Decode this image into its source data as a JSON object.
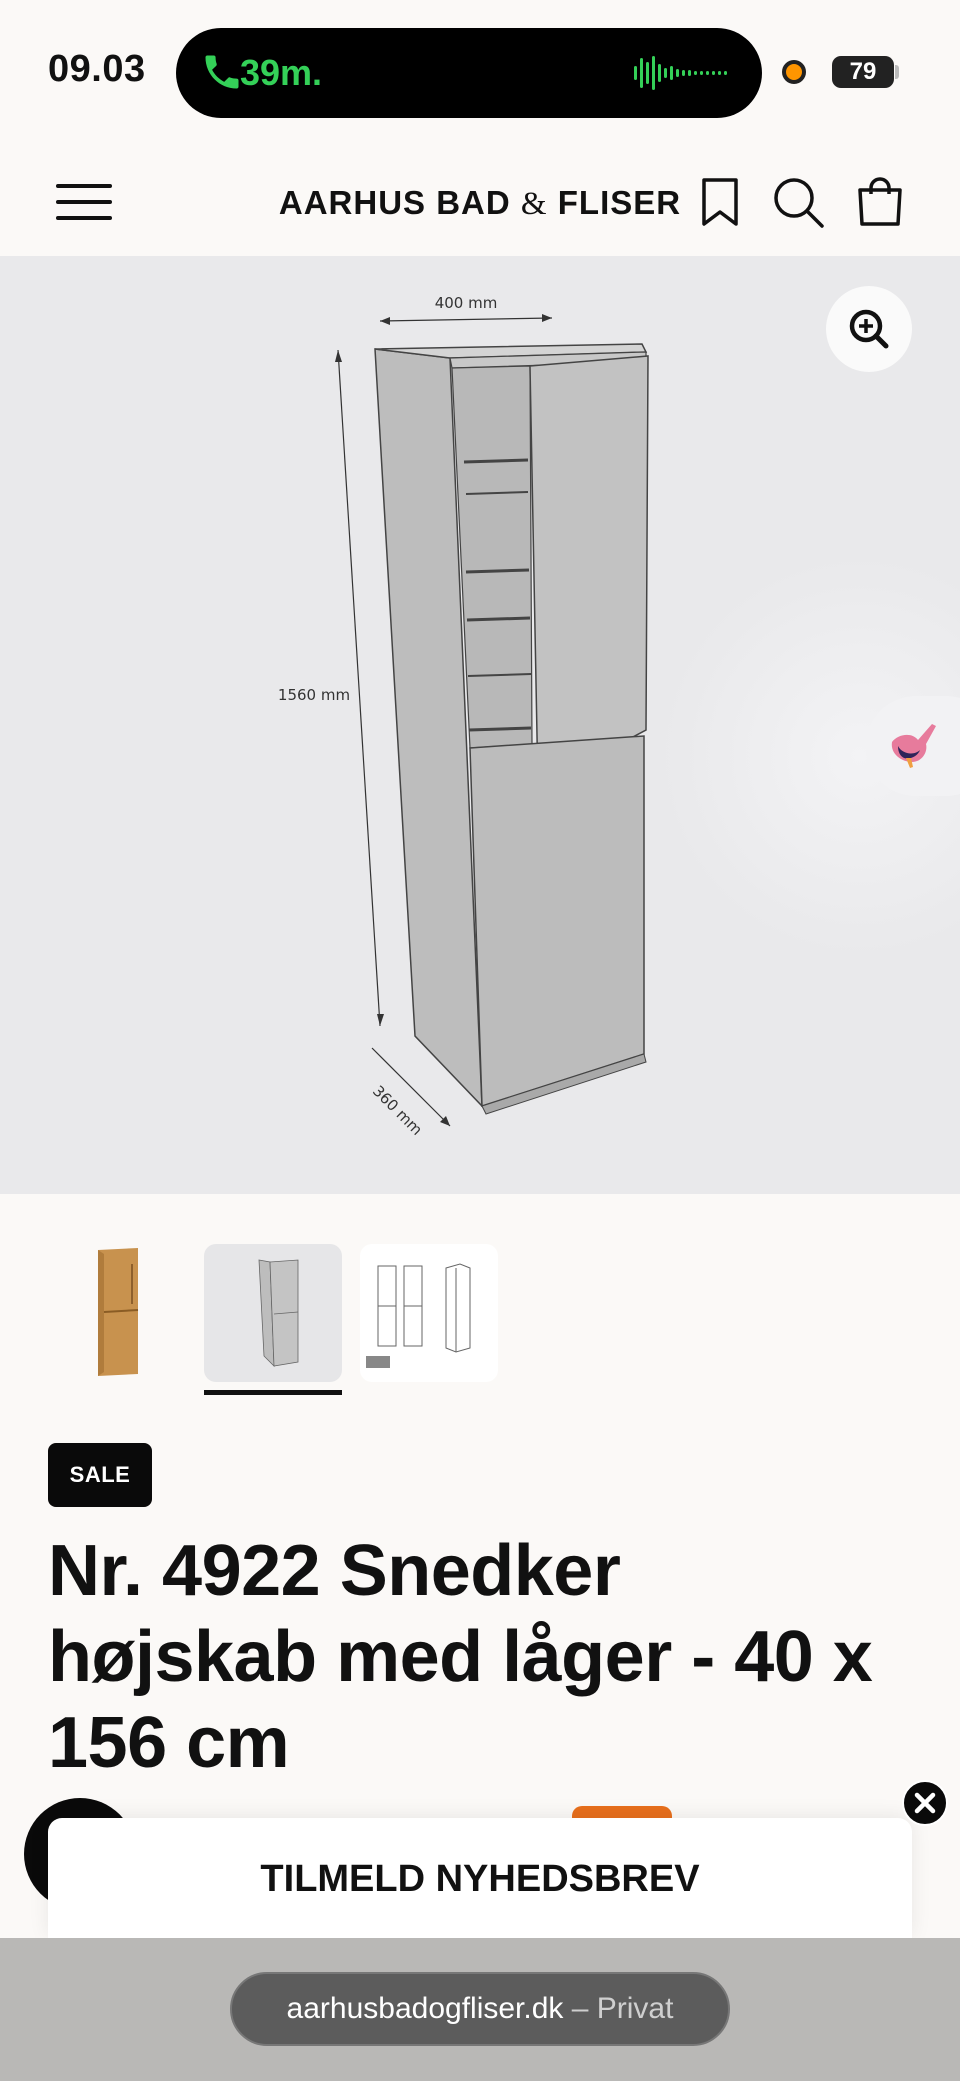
{
  "status_bar": {
    "time": "09.03",
    "call_duration": "39m.",
    "battery": "79"
  },
  "header": {
    "logo_left": "AARHUS BAD",
    "logo_amp": "&",
    "logo_right": "FLISER",
    "icons": [
      "menu-icon",
      "bookmark-icon",
      "search-icon",
      "cart-icon"
    ]
  },
  "product_image": {
    "dim_width": "400 mm",
    "dim_height": "1560 mm",
    "dim_depth": "360 mm"
  },
  "thumbnails": [
    {
      "name": "thumb-wood-cabinet",
      "active": false
    },
    {
      "name": "thumb-dimension-drawing",
      "active": true
    },
    {
      "name": "thumb-technical-drawing",
      "active": false
    }
  ],
  "product": {
    "badge": "SALE",
    "title": "Nr. 4922 Snedker højskab med låger - 40 x 156 cm"
  },
  "newsletter": {
    "label": "TILMELD NYHEDSBREV"
  },
  "browser": {
    "domain": "aarhusbadogfliser.dk",
    "mode": " – Privat"
  },
  "colors": {
    "background": "#fbf9f7",
    "image_bg": "#e9e9eb",
    "call_green": "#34d058",
    "accent_orange": "#e86f1c"
  }
}
